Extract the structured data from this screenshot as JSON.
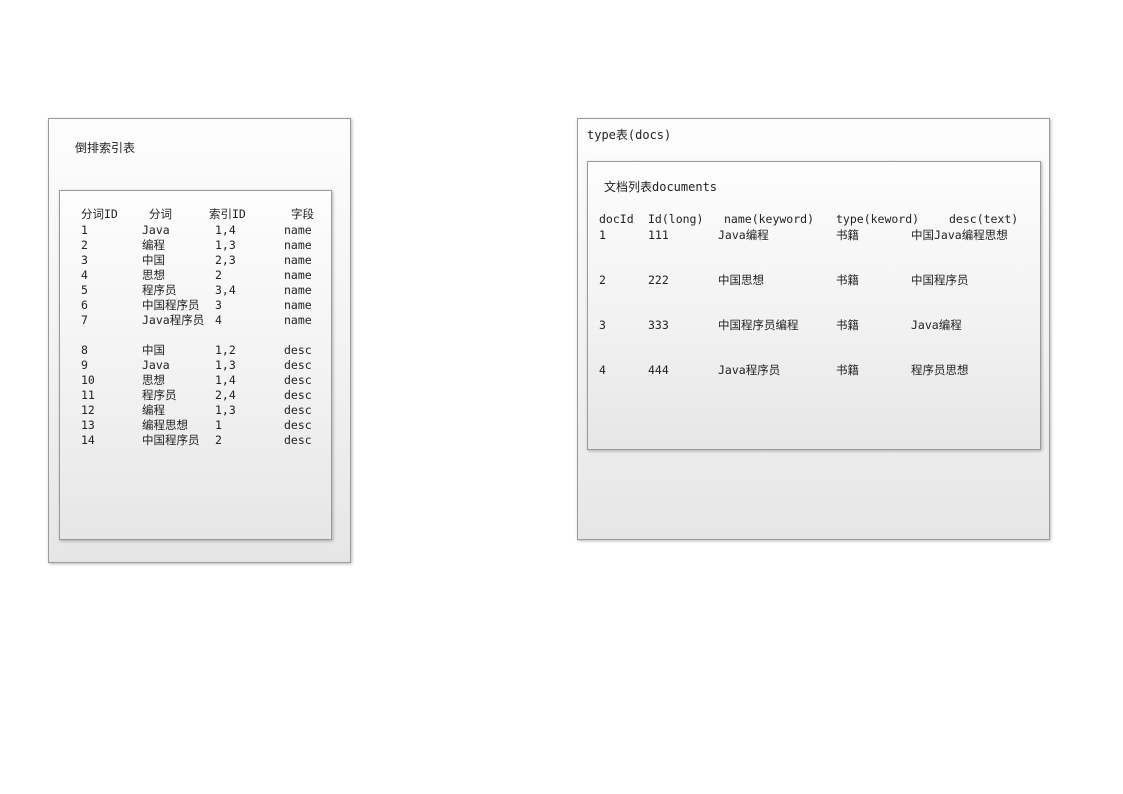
{
  "inverted_index": {
    "title": "倒排索引表",
    "headers": [
      "分词ID",
      "分词",
      "索引ID",
      "字段"
    ],
    "rows": [
      [
        "1",
        "Java",
        "1,4",
        "name"
      ],
      [
        "2",
        "编程",
        "1,3",
        "name"
      ],
      [
        "3",
        "中国",
        "2,3",
        "name"
      ],
      [
        "4",
        "思想",
        "2",
        "name"
      ],
      [
        "5",
        "程序员",
        "3,4",
        "name"
      ],
      [
        "6",
        "中国程序员",
        "3",
        "name"
      ],
      [
        "7",
        "Java程序员",
        "4",
        "name"
      ],
      [
        "8",
        "中国",
        "1,2",
        "desc"
      ],
      [
        "9",
        "Java",
        "1,3",
        "desc"
      ],
      [
        "10",
        "思想",
        "1,4",
        "desc"
      ],
      [
        "11",
        "程序员",
        "2,4",
        "desc"
      ],
      [
        "12",
        "编程",
        "1,3",
        "desc"
      ],
      [
        "13",
        "编程思想",
        "1",
        "desc"
      ],
      [
        "14",
        "中国程序员",
        "2",
        "desc"
      ]
    ]
  },
  "type_table": {
    "title": "type表(docs)",
    "documents": {
      "title": "文档列表documents",
      "headers": [
        "docId",
        "Id(long)",
        "name(keyword)",
        "type(keword)",
        "desc(text)"
      ],
      "rows": [
        [
          "1",
          "111",
          "Java编程",
          "书籍",
          "中国Java编程思想"
        ],
        [
          "2",
          "222",
          "中国思想",
          "书籍",
          "中国程序员"
        ],
        [
          "3",
          "333",
          "中国程序员编程",
          "书籍",
          "Java编程"
        ],
        [
          "4",
          "444",
          "Java程序员",
          "书籍",
          "程序员思想"
        ]
      ]
    }
  }
}
